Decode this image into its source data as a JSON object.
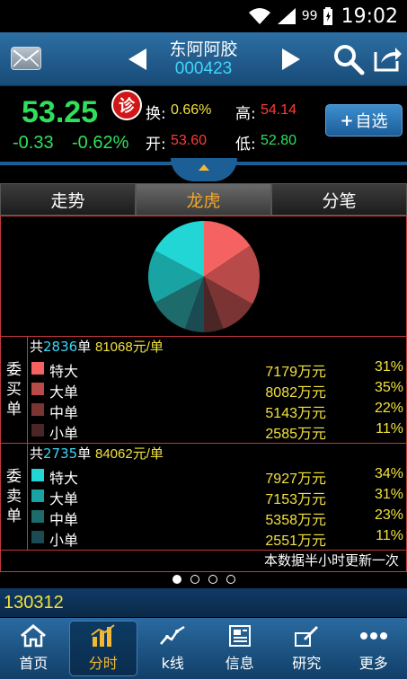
{
  "statusbar": {
    "battery_pct": "99",
    "time": "19:02"
  },
  "header": {
    "stock_name": "东阿阿胶",
    "stock_code": "000423"
  },
  "quote": {
    "price": "53.25",
    "change": "-0.33",
    "change_pct": "-0.62%",
    "diag_label": "诊",
    "turnover_label": "换:",
    "turnover": "0.66%",
    "high_label": "高:",
    "high": "54.14",
    "open_label": "开:",
    "open": "53.60",
    "low_label": "低:",
    "low": "52.80",
    "add_watch_label": "自选",
    "colors": {
      "up": "#ff3b3b",
      "down": "#2ee05c",
      "accent": "#f2e23c"
    }
  },
  "tabs": [
    {
      "label": "走势",
      "active": false
    },
    {
      "label": "龙虎",
      "active": true
    },
    {
      "label": "分笔",
      "active": false
    }
  ],
  "chart_data": {
    "type": "pie",
    "categories": [
      "买特大",
      "买大单",
      "买中单",
      "买小单",
      "卖小单",
      "卖中单",
      "卖大单",
      "卖特大"
    ],
    "values": [
      7179,
      8082,
      5143,
      2585,
      2551,
      5358,
      7153,
      7927
    ],
    "colors": [
      "#f46262",
      "#b84a4a",
      "#7a3434",
      "#4a2626",
      "#1a4a52",
      "#1d6b6b",
      "#1aa3a3",
      "#22d6d6"
    ]
  },
  "buy": {
    "side_label": [
      "委",
      "买",
      "单"
    ],
    "prefix": "共",
    "count": "2836",
    "unit": "单",
    "avg": "81068元/单",
    "rows": [
      {
        "name": "特大",
        "amount": "7179万元",
        "pct": "31%",
        "color": "#f46262"
      },
      {
        "name": "大单",
        "amount": "8082万元",
        "pct": "35%",
        "color": "#b84a4a"
      },
      {
        "name": "中单",
        "amount": "5143万元",
        "pct": "22%",
        "color": "#7a3434"
      },
      {
        "name": "小单",
        "amount": "2585万元",
        "pct": "11%",
        "color": "#4a2626"
      }
    ]
  },
  "sell": {
    "side_label": [
      "委",
      "卖",
      "单"
    ],
    "prefix": "共",
    "count": "2735",
    "unit": "单",
    "avg": "84062元/单",
    "rows": [
      {
        "name": "特大",
        "amount": "7927万元",
        "pct": "34%",
        "color": "#22d6d6"
      },
      {
        "name": "大单",
        "amount": "7153万元",
        "pct": "31%",
        "color": "#1aa3a3"
      },
      {
        "name": "中单",
        "amount": "5358万元",
        "pct": "23%",
        "color": "#1d6b6b"
      },
      {
        "name": "小单",
        "amount": "2551万元",
        "pct": "11%",
        "color": "#1a4a52"
      }
    ]
  },
  "note": "本数据半小时更新一次",
  "pager": {
    "count": 4,
    "active": 0
  },
  "date": "130312",
  "nav": [
    {
      "label": "首页",
      "icon": "home-icon",
      "active": false
    },
    {
      "label": "分时",
      "icon": "timeshare-chart-icon",
      "active": true
    },
    {
      "label": "k线",
      "icon": "kline-icon",
      "active": false
    },
    {
      "label": "信息",
      "icon": "info-icon",
      "active": false
    },
    {
      "label": "研究",
      "icon": "research-icon",
      "active": false
    },
    {
      "label": "更多",
      "icon": "more-icon",
      "active": false
    }
  ]
}
